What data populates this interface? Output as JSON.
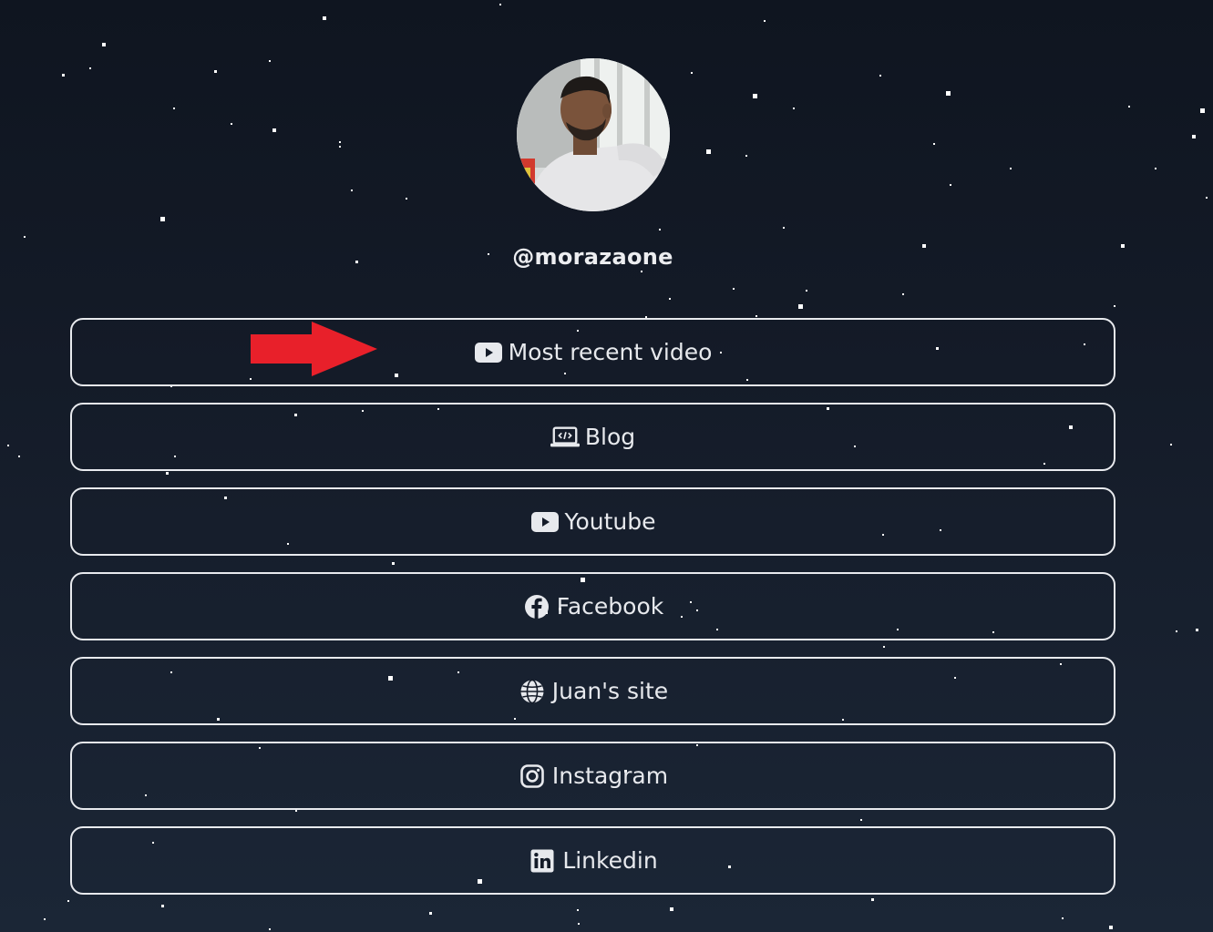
{
  "profile": {
    "username": "@morazaone",
    "avatar_alt": "profile photo"
  },
  "links": [
    {
      "label": "Most recent video",
      "icon": "youtube-icon"
    },
    {
      "label": "Blog",
      "icon": "laptop-code-icon"
    },
    {
      "label": "Youtube",
      "icon": "youtube-icon"
    },
    {
      "label": "Facebook",
      "icon": "facebook-icon"
    },
    {
      "label": "Juan's site",
      "icon": "globe-icon"
    },
    {
      "label": "Instagram",
      "icon": "instagram-icon"
    },
    {
      "label": "Linkedin",
      "icon": "linkedin-icon"
    }
  ],
  "colors": {
    "background_top": "#0f1520",
    "background_bottom": "#1b2636",
    "button_border": "#e8eaee",
    "text": "#e7e9ed",
    "arrow": "#e8202a"
  }
}
